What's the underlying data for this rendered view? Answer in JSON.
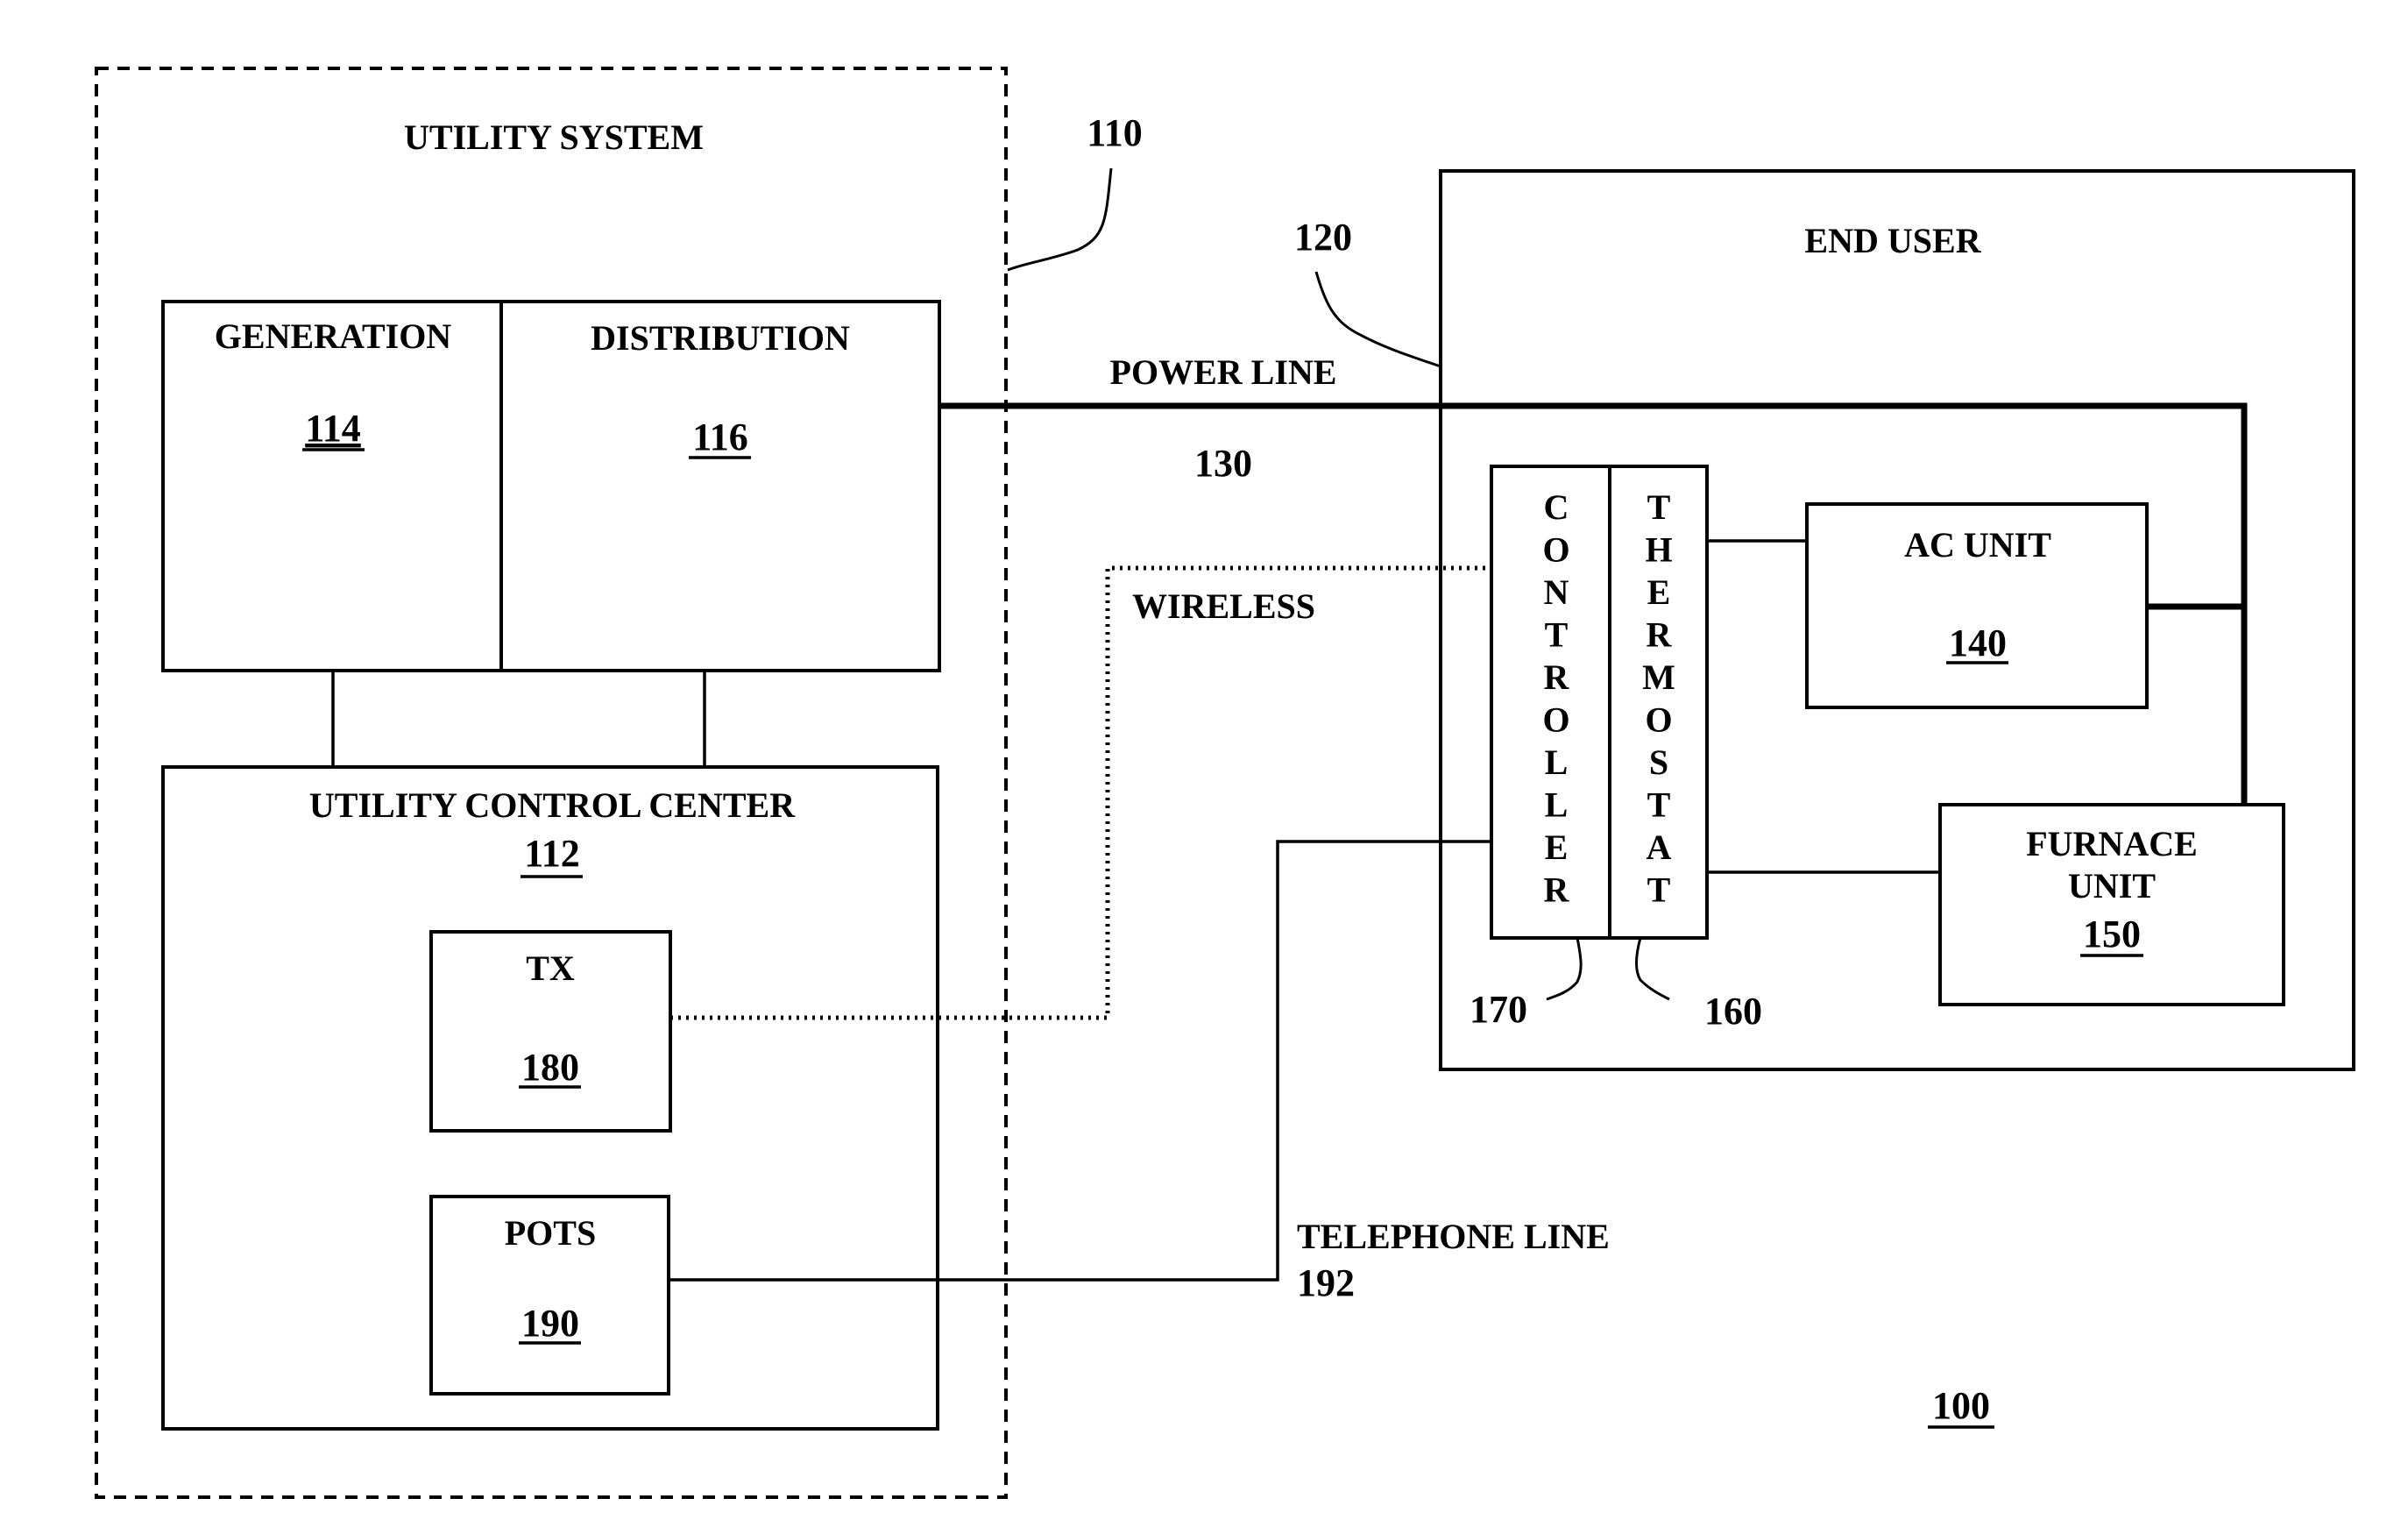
{
  "figure": {
    "reference": "100",
    "reference_underlined": true
  },
  "utility_system": {
    "title": "UTILITY SYSTEM",
    "ref": "110",
    "generation": {
      "label": "GENERATION",
      "ref": "114"
    },
    "distribution": {
      "label": "DISTRIBUTION",
      "ref": "116"
    },
    "control_center": {
      "label": "UTILITY CONTROL CENTER",
      "ref": "112",
      "tx": {
        "label": "TX",
        "ref": "180"
      },
      "pots": {
        "label": "POTS",
        "ref": "190"
      }
    }
  },
  "end_user": {
    "title": "END USER",
    "ref": "120",
    "controller": {
      "label": "CONTROLLER",
      "ref": "170"
    },
    "thermostat": {
      "label": "THERMOSTAT",
      "ref": "160"
    },
    "ac_unit": {
      "label": "AC UNIT",
      "ref": "140"
    },
    "furnace": {
      "label_line1": "FURNACE",
      "label_line2": "UNIT",
      "ref": "150"
    }
  },
  "connections": {
    "power_line": {
      "label": "POWER LINE",
      "ref": "130",
      "style": "solid-thick"
    },
    "wireless": {
      "label": "WIRELESS",
      "style": "dotted"
    },
    "telephone_line": {
      "label": "TELEPHONE LINE",
      "ref": "192",
      "style": "solid"
    }
  }
}
